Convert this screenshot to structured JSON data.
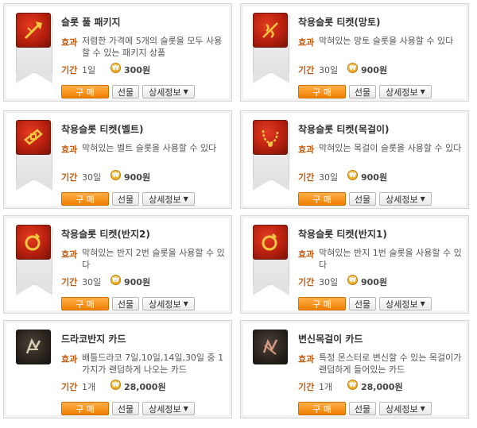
{
  "labels": {
    "effect": "효과",
    "period": "기간",
    "coin_symbol": "₩"
  },
  "buttons": {
    "buy": "구 매",
    "gift": "선물",
    "details": "상세정보"
  },
  "items": [
    {
      "title": "슬롯 풀 패키지",
      "effect": "저렴한 가격에 5개의 슬롯을 모두 사용할 수 있는 패키지 상품",
      "period": "1일",
      "price": "300원",
      "icon": "axe-slot-icon"
    },
    {
      "title": "착용슬롯 티켓(망토)",
      "effect": "막혀있는 망토 슬롯을 사용할 수 있다",
      "period": "30일",
      "price": "900원",
      "icon": "cape-slot-icon"
    },
    {
      "title": "착용슬롯 티켓(벨트)",
      "effect": "막혀있는 벨트 슬롯을 사용할 수 있다",
      "period": "30일",
      "price": "900원",
      "icon": "belt-slot-icon"
    },
    {
      "title": "착용슬롯 티켓(목걸이)",
      "effect": "막혀있는 목걸이 슬롯을 사용할 수 있다",
      "period": "30일",
      "price": "900원",
      "icon": "necklace-slot-icon"
    },
    {
      "title": "착용슬롯 티켓(반지2)",
      "effect": "막혀있는 반지 2번 슬롯을 사용할 수 있다",
      "period": "30일",
      "price": "900원",
      "icon": "ring-slot-icon"
    },
    {
      "title": "착용슬롯 티켓(반지1)",
      "effect": "막혀있는 반지 1번 슬롯을 사용할 수 있다",
      "period": "30일",
      "price": "900원",
      "icon": "ring-slot-icon"
    },
    {
      "title": "드라코반지 카드",
      "effect": "배틀드라코 7일,10일,14일,30일 중 1가지가 랜덤하게 나오는 카드",
      "period": "1개",
      "price": "28,000원",
      "icon": "draco-card-icon"
    },
    {
      "title": "변신목걸이 카드",
      "effect": "특정 몬스터로 변신할 수 있는 목걸이가 랜덤하게 들어있는 카드",
      "period": "1개",
      "price": "28,000원",
      "icon": "transform-card-icon"
    }
  ]
}
